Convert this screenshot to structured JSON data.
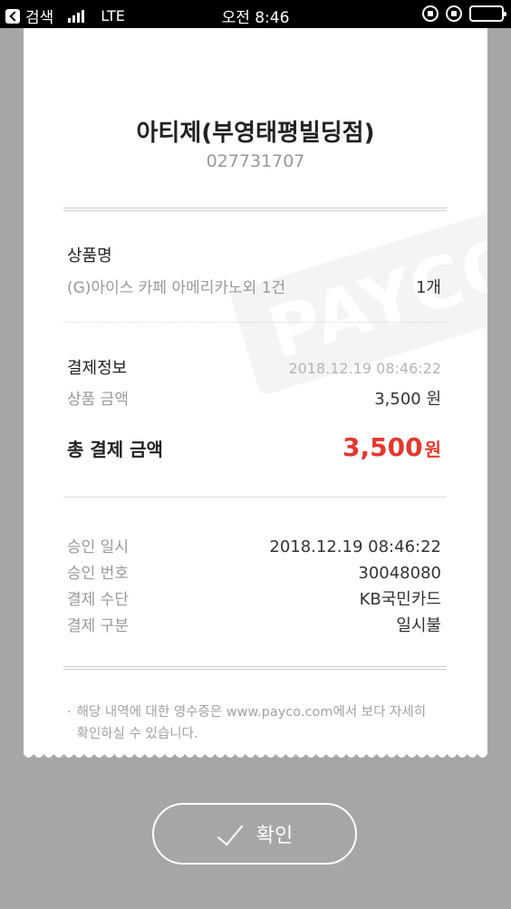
{
  "status_bar": {
    "back_label": "검색",
    "carrier": "LTE",
    "time": "오전 8:46"
  },
  "receipt": {
    "watermark": "PAYCO",
    "store_name": "아티제(부영태평빌딩점)",
    "store_phone": "027731707",
    "product_section_title": "상품명",
    "product_name": "(G)아이스 카페 아메리카노외 1건",
    "product_qty": "1개",
    "payment_section_title": "결제정보",
    "payment_datetime": "2018.12.19 08:46:22",
    "product_amount_label": "상품 금액",
    "product_amount_value": "3,500 원",
    "total_label": "총 결제 금액",
    "total_amount": "3,500",
    "total_unit": "원",
    "details": [
      {
        "label": "승인 일시",
        "value": "2018.12.19 08:46:22"
      },
      {
        "label": "승인 번호",
        "value": "30048080"
      },
      {
        "label": "결제 수단",
        "value": "KB국민카드"
      },
      {
        "label": "결제 구분",
        "value": "일시불"
      }
    ],
    "note_bullet": "·",
    "note": "해당 내역에 대한 영수증은 www.payco.com에서 보다 자세히 확인하실 수 있습니다."
  },
  "confirm_label": "확인",
  "colors": {
    "background": "#a6a6a6",
    "accent_red": "#e2382e"
  }
}
